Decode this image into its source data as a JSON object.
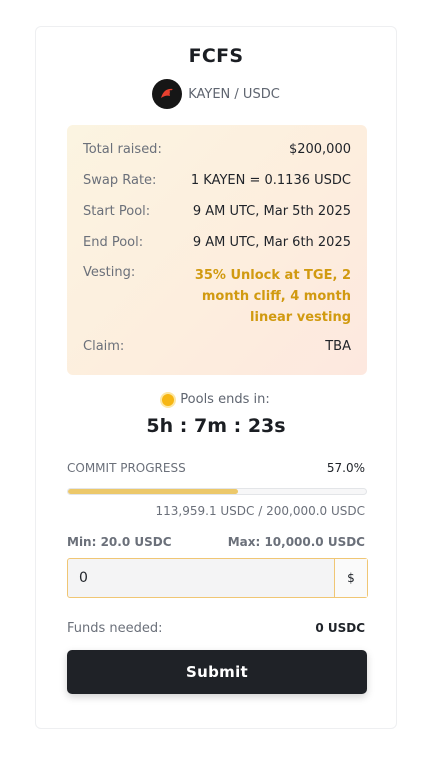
{
  "sale": {
    "title": "FCFS",
    "pair_label": "KAYEN / USDC",
    "token_logo_icon": "kayen-logo-icon"
  },
  "info": {
    "total_raised_label": "Total raised:",
    "total_raised_value": "$200,000",
    "swap_rate_label": "Swap Rate:",
    "swap_rate_value": "1 KAYEN = 0.1136 USDC",
    "start_pool_label": "Start Pool:",
    "start_pool_value": "9 AM UTC, Mar 5th 2025",
    "end_pool_label": "End Pool:",
    "end_pool_value": "9 AM UTC, Mar 6th 2025",
    "vesting_label": "Vesting:",
    "vesting_value": "35% Unlock at TGE, 2 month cliff, 4 month linear vesting",
    "claim_label": "Claim:",
    "claim_value": "TBA"
  },
  "timer": {
    "label": "Pools ends in:",
    "value": "5h : 7m : 23s",
    "status_icon": "status-dot-icon"
  },
  "progress": {
    "label": "COMMIT PROGRESS",
    "percent_text": "57.0%",
    "fraction": 0.57,
    "amounts_text": "113,959.1 USDC / 200,000.0 USDC"
  },
  "limits": {
    "min": "Min: 20.0 USDC",
    "max": "Max: 10,000.0 USDC"
  },
  "amount_input": {
    "value": "0",
    "currency_symbol": "$"
  },
  "funds": {
    "label": "Funds needed:",
    "value": "0 USDC"
  },
  "submit_label": "Submit",
  "colors": {
    "accent_gold": "#d19a10",
    "progress_fill": "#ecc86a",
    "button_dark": "#1f2227"
  }
}
